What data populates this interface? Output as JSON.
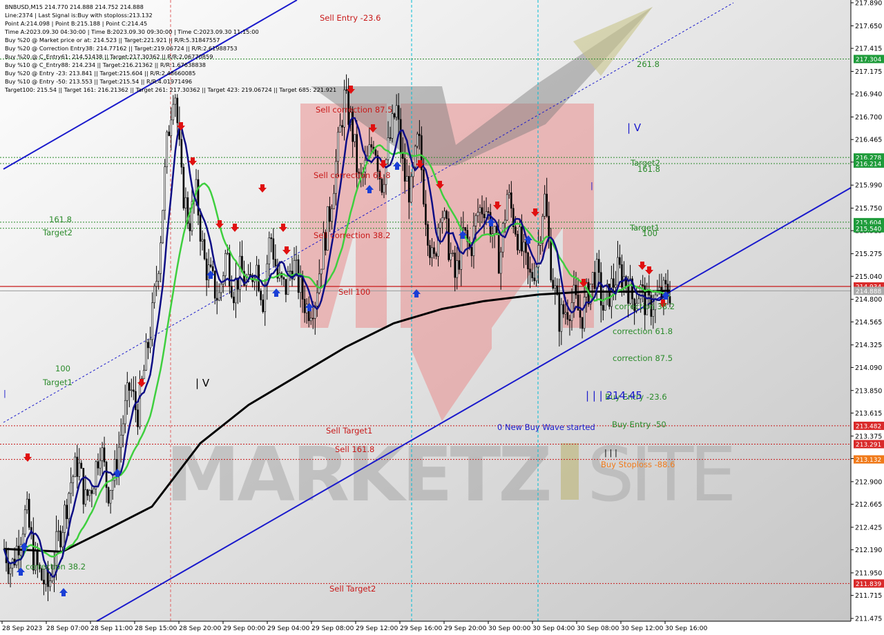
{
  "colors": {
    "background_gradient": [
      "#ffffff",
      "#c9c9c9"
    ],
    "candle": "#000000",
    "ma_fast": "#0d0d85",
    "ma_mid": "#3ecf3e",
    "ma_slow": "#000000",
    "channel": "#1a1acc",
    "level_red": "#c81818",
    "level_green": "#2a8a2a",
    "vline_cyan": "#00bcd4",
    "vline_red": "#e06060",
    "arrow_up": "#1a3fd6",
    "arrow_down": "#e01010",
    "tag_green": "#1e9b3a",
    "tag_red": "#d92a2a",
    "tag_orange": "#f07a1a",
    "tag_gray": "#aaaaaa"
  },
  "info_lines": [
    "BNBUSD,M15  214.770 214.888 214.752 214.888",
    "Line:2374 | Last Signal is:Buy with stoploss:213.132",
    "Point A:214.098 | Point B:215.188 | Point C:214.45",
    "Time A:2023.09.30 04:30:00 | Time B:2023.09.30 09:30:00 | Time C:2023.09.30 11:15:00",
    "Buy %20 @ Market price or at: 214.523 || Target:221.921 || R/R:5.31847557",
    "Buy %20 @ Correction Entry38: 214.77162 || Target:219.06724 || R/R:2.61988753",
    "Buy %20 @ C_Entry61: 214.51438 || Target:217.30362 || R/R:2.06770859",
    "Buy %10 @ C_Entry88: 214.234 || Target:216.21362 || R/R:1.67638838",
    "Buy %20 @ Entry -23: 213.841 || Target:215.604 || R/R:2.48660085",
    "Buy %10 @ Entry -50: 213.553 || Target:215.54 || R/R:4.01971496",
    "Target100: 215.54 || Target 161: 216.21362 || Target 261: 217.30362 || Target 423: 219.06724 || Target 685: 221.921"
  ],
  "chart_data": {
    "type": "candlestick",
    "symbol": "BNBUSD",
    "timeframe": "M15",
    "ylim": [
      211.475,
      217.89
    ],
    "y_ticks": [
      "217.890",
      "217.650",
      "217.415",
      "217.175",
      "216.940",
      "216.700",
      "216.465",
      "216.230",
      "215.990",
      "215.750",
      "215.515",
      "215.275",
      "215.040",
      "214.800",
      "214.565",
      "214.325",
      "214.090",
      "213.850",
      "213.615",
      "213.375",
      "213.140",
      "212.900",
      "212.665",
      "212.425",
      "212.190",
      "211.950",
      "211.715",
      "211.475"
    ],
    "x_ticks": [
      "28 Sep 2023",
      "28 Sep 07:00",
      "28 Sep 11:00",
      "28 Sep 15:00",
      "28 Sep 20:00",
      "29 Sep 00:00",
      "29 Sep 04:00",
      "29 Sep 08:00",
      "29 Sep 12:00",
      "29 Sep 16:00",
      "29 Sep 20:00",
      "30 Sep 00:00",
      "30 Sep 04:00",
      "30 Sep 08:00",
      "30 Sep 12:00",
      "30 Sep 16:00"
    ],
    "ohlc_close_path": [
      212.2,
      212.0,
      212.3,
      212.6,
      212.1,
      211.9,
      211.8,
      212.2,
      212.5,
      212.9,
      213.1,
      212.7,
      212.9,
      213.3,
      212.8,
      213.0,
      213.5,
      213.9,
      213.6,
      214.1,
      214.6,
      215.3,
      216.4,
      217.1,
      216.0,
      215.6,
      215.9,
      215.2,
      215.0,
      214.8,
      215.3,
      214.9,
      215.1,
      214.9,
      215.2,
      214.8,
      215.5,
      215.0,
      214.9,
      215.2,
      214.9,
      214.7,
      214.8,
      215.3,
      215.7,
      216.3,
      216.9,
      216.6,
      216.0,
      216.2,
      216.5,
      216.0,
      216.4,
      216.8,
      216.1,
      215.9,
      216.5,
      215.7,
      215.1,
      215.8,
      215.4,
      215.0,
      215.5,
      215.3,
      215.7,
      215.8,
      215.5,
      215.2,
      215.9,
      215.6,
      215.3,
      215.0,
      215.2,
      215.9,
      215.1,
      214.6,
      214.7,
      214.8,
      214.6,
      214.9,
      215.1,
      214.7,
      214.9,
      215.1,
      215.0,
      214.8,
      214.9,
      214.7,
      214.8,
      214.85,
      214.888
    ],
    "last_price": 214.888,
    "levels": [
      {
        "label": "261.8",
        "value": 217.304,
        "color": "green"
      },
      {
        "label": "Target2",
        "value": 216.278,
        "color": "green"
      },
      {
        "label": "161.8",
        "value": 216.214,
        "color": "green"
      },
      {
        "label": "Target1",
        "value": 215.604,
        "color": "green"
      },
      {
        "label": "100",
        "value": 215.54,
        "color": "green"
      },
      {
        "label": "Sell 100",
        "value": 214.934,
        "color": "red"
      },
      {
        "label": "Buy Entry -50",
        "value": 213.482,
        "color": "red"
      },
      {
        "label": "Sell 161.8",
        "value": 213.291,
        "color": "red"
      },
      {
        "label": "Buy Stoploss -88.6",
        "value": 213.132,
        "color": "red"
      },
      {
        "label": "Sell Target2",
        "value": 211.839,
        "color": "red"
      }
    ],
    "price_tags": [
      {
        "text": "217.304",
        "value": 217.304,
        "color": "green"
      },
      {
        "text": "216.278",
        "value": 216.278,
        "color": "green"
      },
      {
        "text": "216.214",
        "value": 216.214,
        "color": "green"
      },
      {
        "text": "215.604",
        "value": 215.604,
        "color": "green"
      },
      {
        "text": "215.540",
        "value": 215.54,
        "color": "green"
      },
      {
        "text": "214.934",
        "value": 214.934,
        "color": "red"
      },
      {
        "text": "214.888",
        "value": 214.888,
        "color": "gray"
      },
      {
        "text": "213.482",
        "value": 213.482,
        "color": "red"
      },
      {
        "text": "213.291",
        "value": 213.291,
        "color": "red"
      },
      {
        "text": "213.132",
        "value": 213.132,
        "color": "orange"
      },
      {
        "text": "211.839",
        "value": 211.839,
        "color": "red"
      }
    ],
    "annotations": [
      {
        "text": "Sell Entry -23.6",
        "color": "red"
      },
      {
        "text": "Sell correction 87.5",
        "color": "red"
      },
      {
        "text": "Sell correction 61.8",
        "color": "red"
      },
      {
        "text": "Sell correction 38.2",
        "color": "red"
      },
      {
        "text": "Sell 100",
        "color": "red"
      },
      {
        "text": "Sell Target1",
        "color": "red"
      },
      {
        "text": "Sell 161.8",
        "color": "red"
      },
      {
        "text": "Sell Target2",
        "color": "red"
      },
      {
        "text": "261.8",
        "color": "green"
      },
      {
        "text": "Target2",
        "color": "green"
      },
      {
        "text": "161.8",
        "color": "green"
      },
      {
        "text": "Target1",
        "color": "green"
      },
      {
        "text": "100",
        "color": "green"
      },
      {
        "text": "161.8",
        "color": "green"
      },
      {
        "text": "Target2",
        "color": "green"
      },
      {
        "text": "100",
        "color": "green"
      },
      {
        "text": "Target1",
        "color": "green"
      },
      {
        "text": "correction 38.2",
        "color": "green"
      },
      {
        "text": "correction 61.8",
        "color": "green"
      },
      {
        "text": "correction 87.5",
        "color": "green"
      },
      {
        "text": "Buy Entry -23.6",
        "color": "green"
      },
      {
        "text": "Buy Entry -50",
        "color": "green"
      },
      {
        "text": "Buy Stoploss -88.6",
        "color": "orange"
      },
      {
        "text": "correction 38.2",
        "color": "green"
      },
      {
        "text": "0 New Buy Wave started",
        "color": "blue"
      },
      {
        "text": "| | | 214.45",
        "color": "blue"
      },
      {
        "text": "| V",
        "color": "black"
      },
      {
        "text": "| V",
        "color": "blue"
      },
      {
        "text": "|",
        "color": "blue"
      },
      {
        "text": "|",
        "color": "blue"
      },
      {
        "text": "| | |",
        "color": "black"
      }
    ],
    "watermark": "MARKETZISITE"
  }
}
